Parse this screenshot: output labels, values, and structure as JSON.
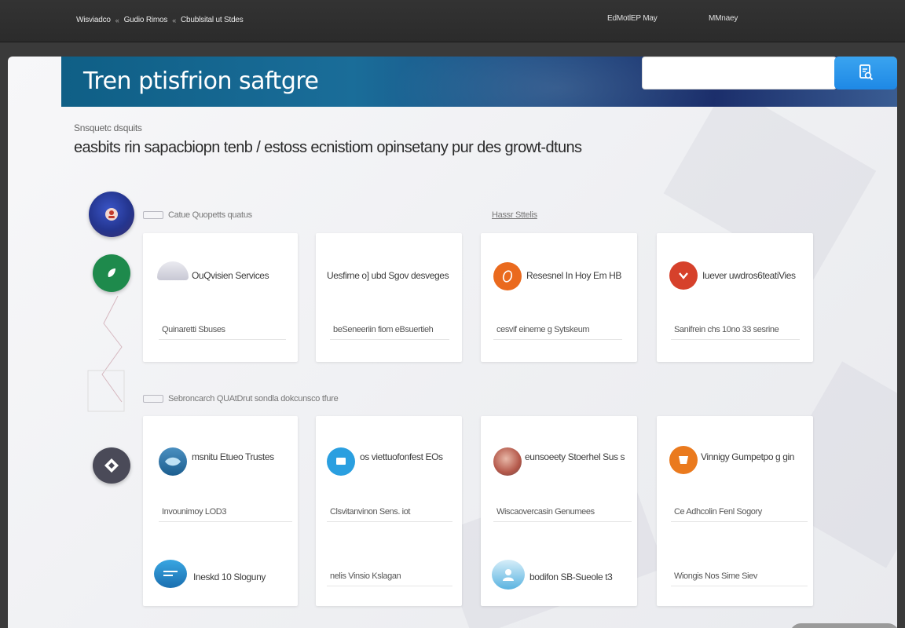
{
  "topbar": {
    "breadcrumb": [
      "Wisviadco",
      "Gudio Rimos",
      "Cbublsital ut Stdes"
    ],
    "link_1": "EdMotlEP May",
    "link_2": "MMnaey"
  },
  "banner": {
    "title": "Tren ptisfrion  saftgre",
    "search_placeholder": "",
    "search_icon": "search-doc-icon"
  },
  "page": {
    "subtitle": "Snsquetc dsquits",
    "headline": "easbits rin sapacbiopn tenb / estoss ecnistiom opinsetany  pur des growt-dtuns"
  },
  "sections": [
    {
      "label": "Catue Quopetts quatus"
    },
    {
      "label": "Hassr Sttelis"
    },
    {
      "label": "Sebroncarch QUAtDrut sondla dokcunsco tfure"
    }
  ],
  "cards": [
    {
      "title": "OuQvisien Services",
      "meta": "Quinaretti Sbuses"
    },
    {
      "title": "Uesfirne o] ubd Sgov desveges",
      "meta": "beSeneeriin fiom eBsuertieh"
    },
    {
      "title": "Resesnel In Hoy Em HB",
      "meta": "cesvif eineme g Sytskeum"
    },
    {
      "title": "Iuever  uwdros6teatiVies",
      "meta": "Sanifrein chs 10no 33 sesrine"
    },
    {
      "title": "msnitu Etueo Trustes",
      "meta": "Invounimoy LOD3",
      "meta2": "Ineskd 10 Sloguny"
    },
    {
      "title": "os viettuofonfest  EOs",
      "meta": "Clsvitanvinon Sens. iot",
      "meta2": "nelis Vinsio Kslagan"
    },
    {
      "title": "eunsoeety Stoerhel Sus s",
      "meta": "Wiscaovercasin Genumees",
      "meta2": "bodifon SB-Sueole t3"
    },
    {
      "title": "Vinnigy Gumpetpo g  gin",
      "meta": "Ce Adhcolin Fenl Sogory",
      "meta2": "Wiongis Nos Sime Siev"
    }
  ],
  "colors": {
    "banner_start": "#0f5f86",
    "banner_end": "#1b2e6b",
    "accent_blue": "#1e88e5",
    "rail_navy": "#2a3f9a",
    "rail_green": "#1e8a4c",
    "rail_gray": "#4a4a58",
    "icon_orange": "#ea6a1e",
    "icon_red": "#d6412b",
    "icon_lightblue": "#2a9fe0"
  }
}
